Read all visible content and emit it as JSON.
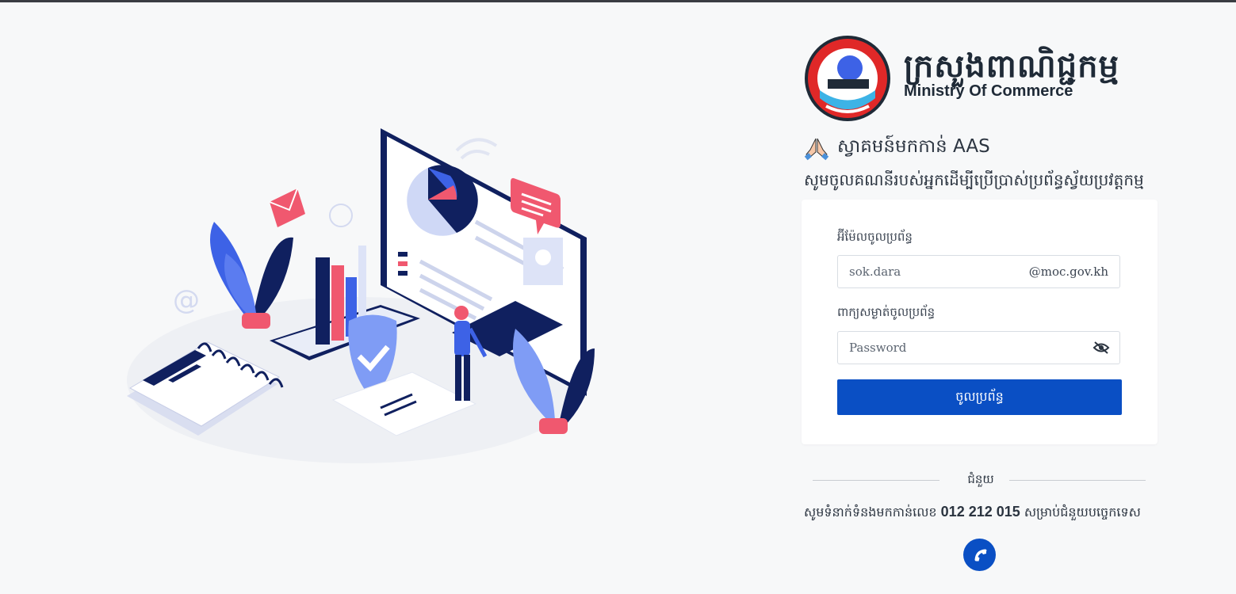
{
  "brand": {
    "khmer_name": "ក្រសួងពាណិជ្ជកម្ម",
    "english_name": "Ministry Of Commerce",
    "logo_icon": "ministry-seal-icon"
  },
  "welcome": {
    "icon": "pray-hands-icon",
    "text": "ស្វាគមន៍មកកាន់ AAS",
    "subtitle": "សូមចូលគណនីរបស់អ្នកដើម្បីប្រើប្រាស់ប្រព័ន្ធស្វ័យប្រវត្តកម្ម"
  },
  "form": {
    "email_label": "អ៊ីម៉ែលចូលប្រព័ន្ធ",
    "email_placeholder": "sok.dara",
    "email_suffix": "@moc.gov.kh",
    "password_label": "ពាក្យសម្ងាត់ចូលប្រព័ន្ធ",
    "password_placeholder": "Password",
    "eye_icon": "eye-slash-icon",
    "submit_label": "ចូលប្រព័ន្ធ"
  },
  "help": {
    "label": "ជំនួយ",
    "contact_prefix": "សូមទំនាក់ទំនងមកកាន់លេខ",
    "phone": "012 212 015",
    "contact_suffix": "សម្រាប់ជំនួយបច្ចេកទេស",
    "call_icon": "phone-icon"
  },
  "colors": {
    "primary": "#0a4fc4",
    "background": "#f7f8f9",
    "navy": "#0f1f5c",
    "pink": "#f0586f"
  }
}
